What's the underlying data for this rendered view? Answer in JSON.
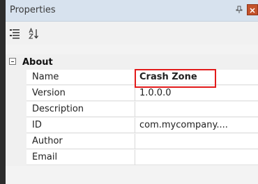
{
  "panel": {
    "title": "Properties",
    "pin_icon": "pin-icon",
    "close_icon": "close-icon",
    "accent_highlight": "#e21b1b"
  },
  "toolbar": {
    "categorized_icon": "categorized-icon",
    "alphabetical_icon": "alphabetical-icon"
  },
  "category": {
    "label": "About",
    "toggle_icon": "collapse-icon"
  },
  "rows": [
    {
      "name": "Name",
      "value": "Crash Zone"
    },
    {
      "name": "Version",
      "value": "1.0.0.0"
    },
    {
      "name": "Description",
      "value": ""
    },
    {
      "name": "ID",
      "value": "com.mycompany...."
    },
    {
      "name": "Author",
      "value": ""
    },
    {
      "name": "Email",
      "value": ""
    }
  ]
}
